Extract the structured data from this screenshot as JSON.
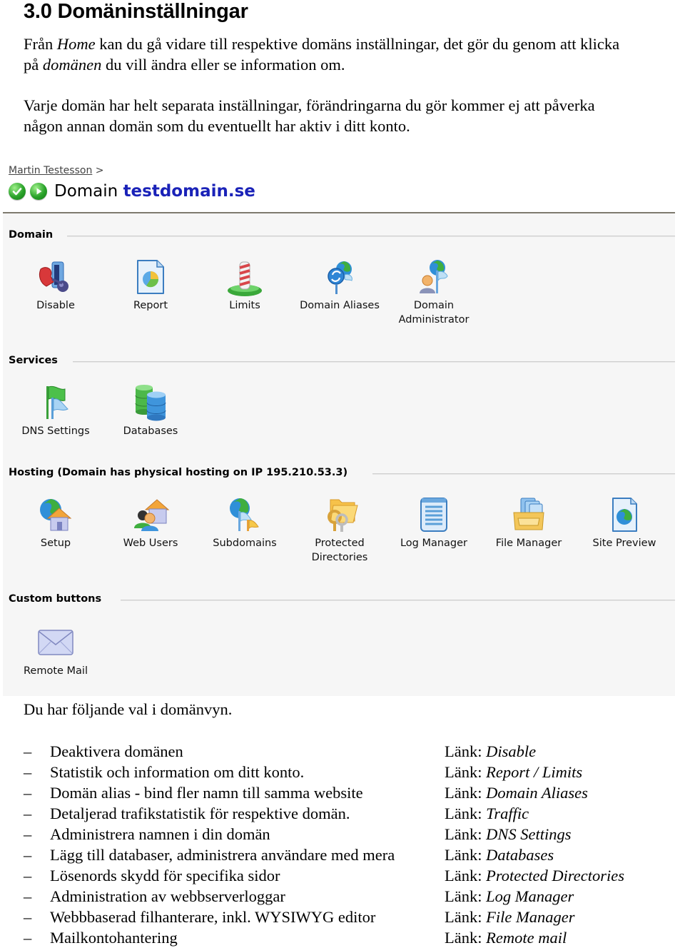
{
  "document": {
    "title": "3.0 Domäninställningar",
    "paragraph1": {
      "part1": "Från ",
      "em1": "Home",
      "part2": " kan du gå vidare till respektive domäns inställningar, det gör du genom att klicka",
      "part3": "på ",
      "em2": "domänen",
      "part4": " du vill ändra eller se information om."
    },
    "paragraph2": {
      "line1": "Varje domän har helt separata inställningar, förändringarna du gör kommer ej att påverka",
      "line2": "någon annan domän som du eventuellt har aktiv i ditt konto."
    },
    "after_screenshot": "Du har följande val i domänvyn.",
    "options": [
      {
        "dash": "–",
        "description": "Deaktivera domänen",
        "link_prefix": "Länk: ",
        "link": "Disable"
      },
      {
        "dash": "–",
        "description": "Statistik och information om ditt konto.",
        "link_prefix": "Länk: ",
        "link": "Report / Limits"
      },
      {
        "dash": "–",
        "description": "Domän alias - bind fler namn till samma website",
        "link_prefix": "Länk: ",
        "link": "Domain Aliases"
      },
      {
        "dash": "–",
        "description": "Detaljerad trafikstatistik för respektive domän.",
        "link_prefix": "Länk: ",
        "link": "Traffic"
      },
      {
        "dash": "–",
        "description": "Administrera namnen i din domän",
        "link_prefix": "Länk: ",
        "link": "DNS Settings"
      },
      {
        "dash": "–",
        "description": "Lägg till databaser, administrera användare med mera",
        "link_prefix": "Länk: ",
        "link": "Databases"
      },
      {
        "dash": "–",
        "description": "Lösenords skydd för specifika sidor",
        "link_prefix": "Länk: ",
        "link": "Protected Directories"
      },
      {
        "dash": "–",
        "description": "Administration av webbserverloggar",
        "link_prefix": "Länk: ",
        "link": "Log Manager"
      },
      {
        "dash": "–",
        "description": "Webbbaserad filhanterare, inkl. WYSIWYG editor",
        "link_prefix": "Länk: ",
        "link": "File Manager"
      },
      {
        "dash": "–",
        "description": "Mailkontohantering",
        "link_prefix": "Länk: ",
        "link": "Remote mail"
      }
    ]
  },
  "screenshot": {
    "breadcrumb": {
      "user": "Martin Testesson",
      "separator": ">"
    },
    "header": {
      "label": "Domain",
      "domain": "testdomain.se",
      "status_icons": [
        "check-circle-icon",
        "play-circle-icon"
      ]
    },
    "colors": {
      "panel_bg": "#f6f6f6",
      "domain_link": "#1a22b8",
      "status_green": "#2aa22a"
    },
    "sections": [
      {
        "title": "Domain",
        "items": [
          {
            "label": "Disable",
            "icon": "disable-icon"
          },
          {
            "label": "Report",
            "icon": "report-icon"
          },
          {
            "label": "Limits",
            "icon": "limits-icon"
          },
          {
            "label": "Domain Aliases",
            "icon": "domain-aliases-icon"
          },
          {
            "label": "Domain\nAdministrator",
            "icon": "domain-administrator-icon"
          }
        ]
      },
      {
        "title": "Services",
        "items": [
          {
            "label": "DNS Settings",
            "icon": "dns-settings-icon"
          },
          {
            "label": "Databases",
            "icon": "databases-icon"
          }
        ]
      },
      {
        "title": "Hosting (Domain has physical hosting on IP 195.210.53.3)",
        "items": [
          {
            "label": "Setup",
            "icon": "setup-icon"
          },
          {
            "label": "Web Users",
            "icon": "web-users-icon"
          },
          {
            "label": "Subdomains",
            "icon": "subdomains-icon"
          },
          {
            "label": "Protected\nDirectories",
            "icon": "protected-directories-icon"
          },
          {
            "label": "Log Manager",
            "icon": "log-manager-icon"
          },
          {
            "label": "File Manager",
            "icon": "file-manager-icon"
          },
          {
            "label": "Site Preview",
            "icon": "site-preview-icon"
          }
        ]
      },
      {
        "title": "Custom buttons",
        "items": [
          {
            "label": "Remote Mail",
            "icon": "remote-mail-icon"
          }
        ]
      }
    ]
  }
}
